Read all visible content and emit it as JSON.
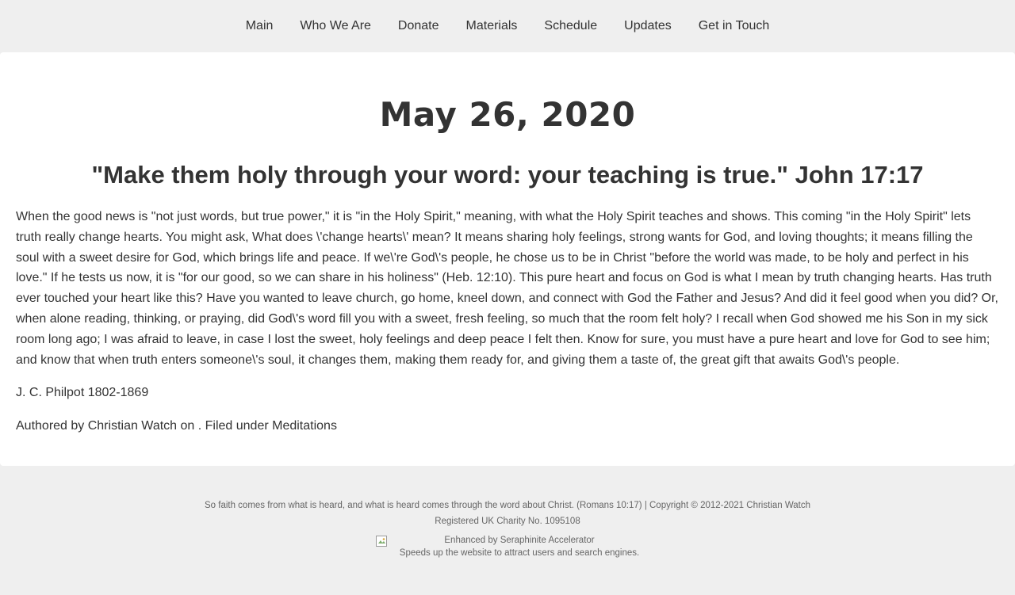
{
  "nav": {
    "items": [
      "Main",
      "Who We Are",
      "Donate",
      "Materials",
      "Schedule",
      "Updates",
      "Get in Touch"
    ]
  },
  "post": {
    "date": "May 26, 2020",
    "verse": "\"Make them holy through your word: your teaching is true.\" John 17:17",
    "body": "When the good news is \"not just words, but true power,\" it is \"in the Holy Spirit,\" meaning, with what the Holy Spirit teaches and shows. This coming \"in the Holy Spirit\" lets truth really change hearts. You might ask, What does \\'change hearts\\' mean? It means sharing holy feelings, strong wants for God, and loving thoughts; it means filling the soul with a sweet desire for God, which brings life and peace. If we\\'re God\\'s people, he chose us to be in Christ \"before the world was made, to be holy and perfect in his love.\" If he tests us now, it is \"for our good, so we can share in his holiness\" (Heb. 12:10). This pure heart and focus on God is what I mean by truth changing hearts. Has truth ever touched your heart like this? Have you wanted to leave church, go home, kneel down, and connect with God the Father and Jesus? And did it feel good when you did? Or, when alone reading, thinking, or praying, did God\\'s word fill you with a sweet, fresh feeling, so much that the room felt holy? I recall when God showed me his Son in my sick room long ago; I was afraid to leave, in case I lost the sweet, holy feelings and deep peace I felt then. Know for sure, you must have a pure heart and love for God to see him; and know that when truth enters someone\\'s soul, it changes them, making them ready for, and giving them a taste of, the great gift that awaits God\\'s people.",
    "author": "J. C. Philpot 1802-1869",
    "meta": "Authored by Christian Watch on . Filed under Meditations"
  },
  "footer": {
    "line1": "So faith comes from what is heard, and what is heard comes through the word about Christ. (Romans 10:17) | Copyright © 2012-2021 Christian Watch",
    "line2": "Registered UK Charity No. 1095108",
    "badge_line1": "Enhanced by Seraphinite Accelerator",
    "badge_line2": "Speeds up the website to attract users and search engines.",
    "badge_icon": "broken-image-icon"
  },
  "colors": {
    "page_bg": "#efefef",
    "card_bg": "#ffffff",
    "text": "#333333",
    "footer_text": "#666666"
  }
}
